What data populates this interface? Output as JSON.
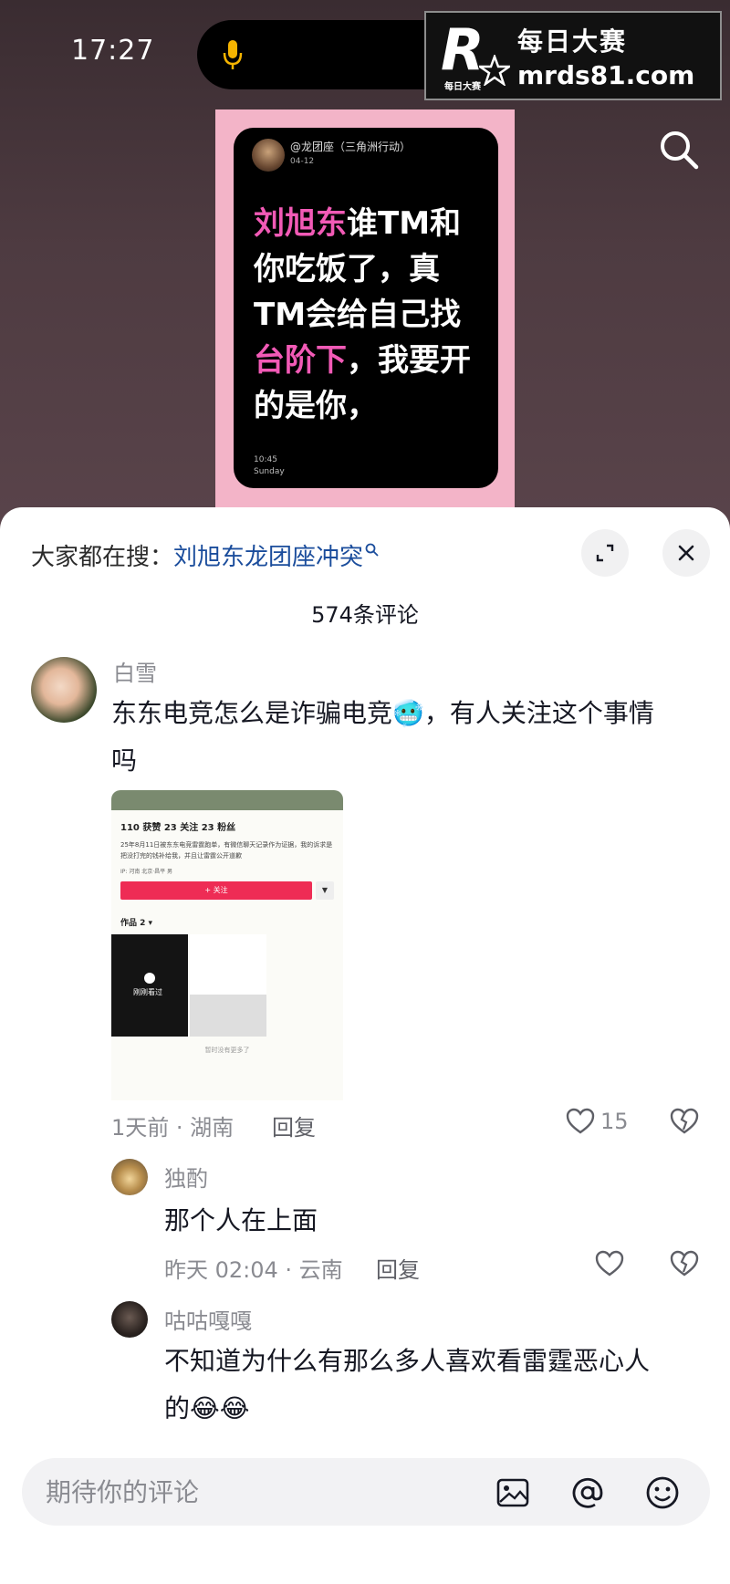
{
  "status_bar": {
    "time": "17:27"
  },
  "watermark": {
    "logo_letter": "R",
    "logo_small": "每日大赛",
    "title": "每日大赛",
    "url": "mrds81.com"
  },
  "video": {
    "card_user": "@龙团座（三角洲行动）",
    "card_date": "04-12",
    "card_text_lines": [
      [
        {
          "t": "刘旭东",
          "pink": true
        },
        {
          "t": "谁TM和",
          "pink": false
        }
      ],
      [
        {
          "t": "你吃饭了，真",
          "pink": false
        }
      ],
      [
        {
          "t": "TM会给自己找",
          "pink": false
        }
      ],
      [
        {
          "t": "台阶下",
          "pink": true
        },
        {
          "t": "，我要开",
          "pink": false
        }
      ],
      [
        {
          "t": "的是你，",
          "pink": false
        }
      ]
    ],
    "card_time": "10:45",
    "card_day": "Sunday"
  },
  "sheet": {
    "hot_search_prefix": "大家都在搜：",
    "hot_search_link": "刘旭东龙团座冲突",
    "comment_count": "574条评论"
  },
  "comments": [
    {
      "username": "白雪",
      "text_line1": "东东电竞怎么是诈骗电竞🥶，有人关注这个事情",
      "text_line2": "吗",
      "meta": "1天前 · 湖南",
      "reply": "回复",
      "likes": "15"
    }
  ],
  "embedded_screenshot": {
    "stats": "110 获赞   23 关注   23 粉丝",
    "desc": "25年8月11日被东东电竞雷霆跑单，有微信聊天记录作为证据，我的诉求是把没打完的钱补给我，并且让雷霆公开道歉",
    "tags": "IP: 河南   北京·昌平   男",
    "follow": "+ 关注",
    "works": "作品 2 ▾",
    "watched": "刚刚看过",
    "nomore": "暂时没有更多了"
  },
  "replies": [
    {
      "username": "独酌",
      "text": "那个人在上面",
      "meta": "昨天 02:04 · 云南",
      "reply": "回复"
    },
    {
      "username": "咕咕嘎嘎",
      "text_line1": "不知道为什么有那么多人喜欢看雷霆恶心人",
      "text_line2": "的😂😂"
    }
  ],
  "input": {
    "placeholder": "期待你的评论"
  }
}
